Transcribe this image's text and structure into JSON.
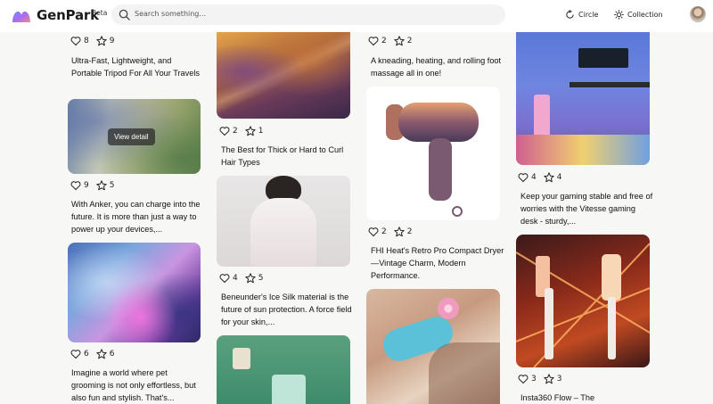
{
  "header": {
    "brand": "GenPark",
    "beta": "Beta",
    "search_placeholder": "Search something...",
    "nav_circle": "Circle",
    "nav_collection": "Collection"
  },
  "cards": [
    {
      "id": "tripod",
      "likes": "8",
      "stars": "9",
      "title": "Ultra-Fast, Lightweight, and Portable Tripod For All Your Travels"
    },
    {
      "id": "anker",
      "likes": "9",
      "stars": "5",
      "title": "With Anker, you can charge into the future. It is more than just a way to power up your devices,...",
      "overlay": "View detail"
    },
    {
      "id": "pet",
      "likes": "6",
      "stars": "6",
      "title": "Imagine a world where pet grooming is not only effortless, but also fun and stylish. That's..."
    },
    {
      "id": "curler",
      "likes": "2",
      "stars": "1",
      "title": "The Best for Thick or Hard to Curl Hair Types"
    },
    {
      "id": "ice-silk",
      "likes": "4",
      "stars": "5",
      "title": "Beneunder's Ice Silk material is the future of sun protection. A force field for your skin,..."
    },
    {
      "id": "massage",
      "likes": "2",
      "stars": "2",
      "title": "A kneading, heating, and rolling foot massage all in one!"
    },
    {
      "id": "dryer",
      "likes": "2",
      "stars": "2",
      "title": "FHI Heat's Retro Pro Compact Dryer—Vintage Charm, Modern Performance."
    },
    {
      "id": "desk",
      "likes": "4",
      "stars": "4",
      "title": "Keep your gaming stable and free of worries with the Vitesse gaming desk - sturdy,..."
    },
    {
      "id": "insta360",
      "likes": "3",
      "stars": "3",
      "title": "Insta360 Flow – The"
    }
  ]
}
